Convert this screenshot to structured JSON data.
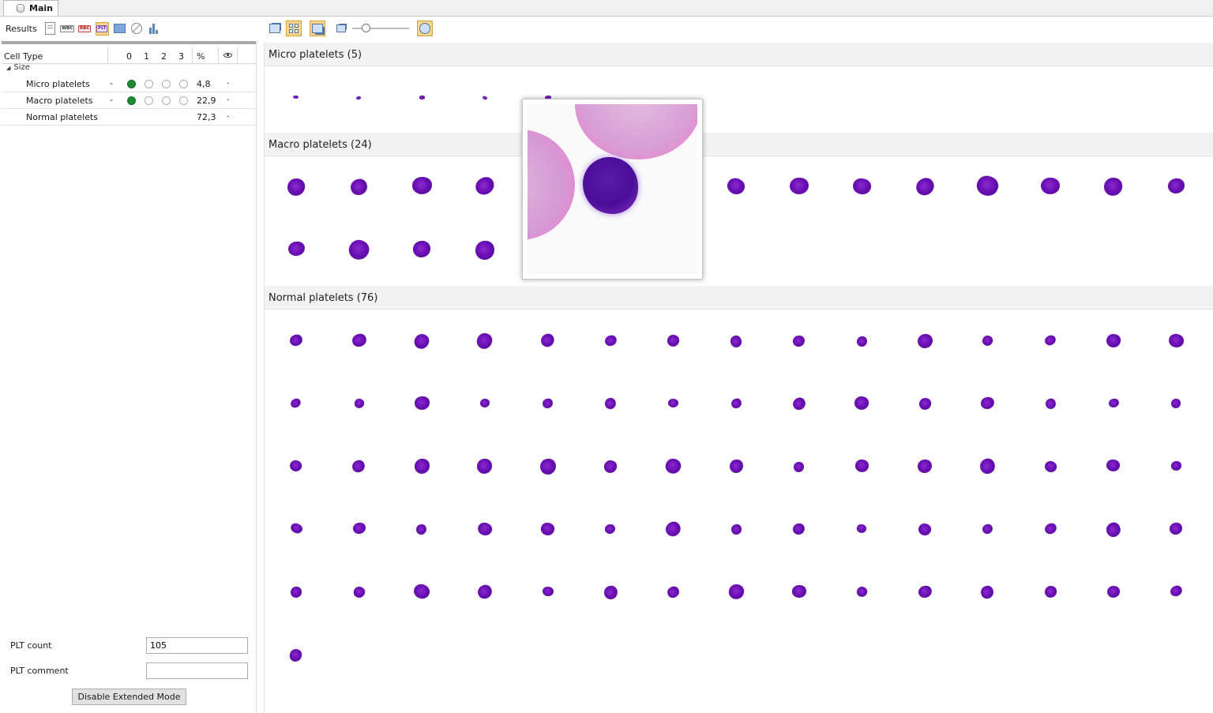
{
  "tab": {
    "label": "Main"
  },
  "toolbar": {
    "results_label": "Results",
    "wbc_label": "WBC",
    "rbc_label": "RBC",
    "plt_label": "PLT"
  },
  "grid": {
    "col_cell_type": "Cell Type",
    "col_0": "0",
    "col_1": "1",
    "col_2": "2",
    "col_3": "3",
    "col_pct": "%",
    "group": "Size",
    "rows": [
      {
        "name": "Micro platelets",
        "dash": "-",
        "grade": 0,
        "pct": "4,8",
        "dot": "·"
      },
      {
        "name": "Macro platelets",
        "dash": "-",
        "grade": 0,
        "pct": "22,9",
        "dot": "·"
      },
      {
        "name": "Normal platelets",
        "dash": "",
        "grade": null,
        "pct": "72,3",
        "dot": "·"
      }
    ]
  },
  "form": {
    "plt_count_label": "PLT count",
    "plt_count_value": "105",
    "plt_comment_label": "PLT comment",
    "plt_comment_value": "",
    "disable_button": "Disable Extended Mode"
  },
  "gallery": {
    "sections": [
      {
        "title": "Micro platelets (5)",
        "count": 5
      },
      {
        "title": "Macro platelets (24)",
        "count": 24
      },
      {
        "title": "Normal platelets (76)",
        "count": 76
      }
    ]
  },
  "colors": {
    "accent_active": "#fbd68a",
    "grade_on": "#1e8a34",
    "platelet_stain": "#6a10b4"
  },
  "zoom": {
    "slider_fraction": 0.2
  }
}
